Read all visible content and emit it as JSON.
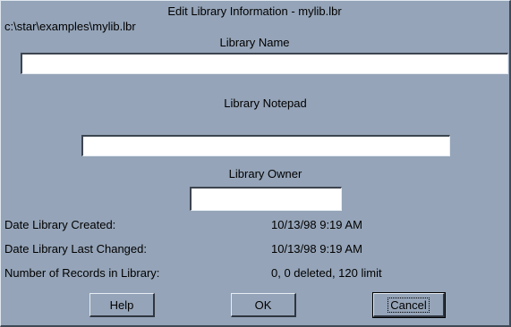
{
  "dialog": {
    "title": "Edit Library Information - mylib.lbr",
    "path": "c:\\star\\examples\\mylib.lbr"
  },
  "fields": {
    "name_label": "Library Name",
    "name_value": "",
    "notepad_label": "Library Notepad",
    "notepad_value": "",
    "owner_label": "Library Owner",
    "owner_value": ""
  },
  "info": {
    "created_label": "Date Library Created:",
    "created_value": "10/13/98 9:19 AM",
    "changed_label": "Date Library Last Changed:",
    "changed_value": "10/13/98 9:19 AM",
    "records_label": "Number of Records in Library:",
    "records_value": "0, 0 deleted, 120 limit"
  },
  "buttons": {
    "help": "Help",
    "ok": "OK",
    "cancel": "Cancel"
  },
  "colors": {
    "dialog_bg": "#95a4b8"
  }
}
